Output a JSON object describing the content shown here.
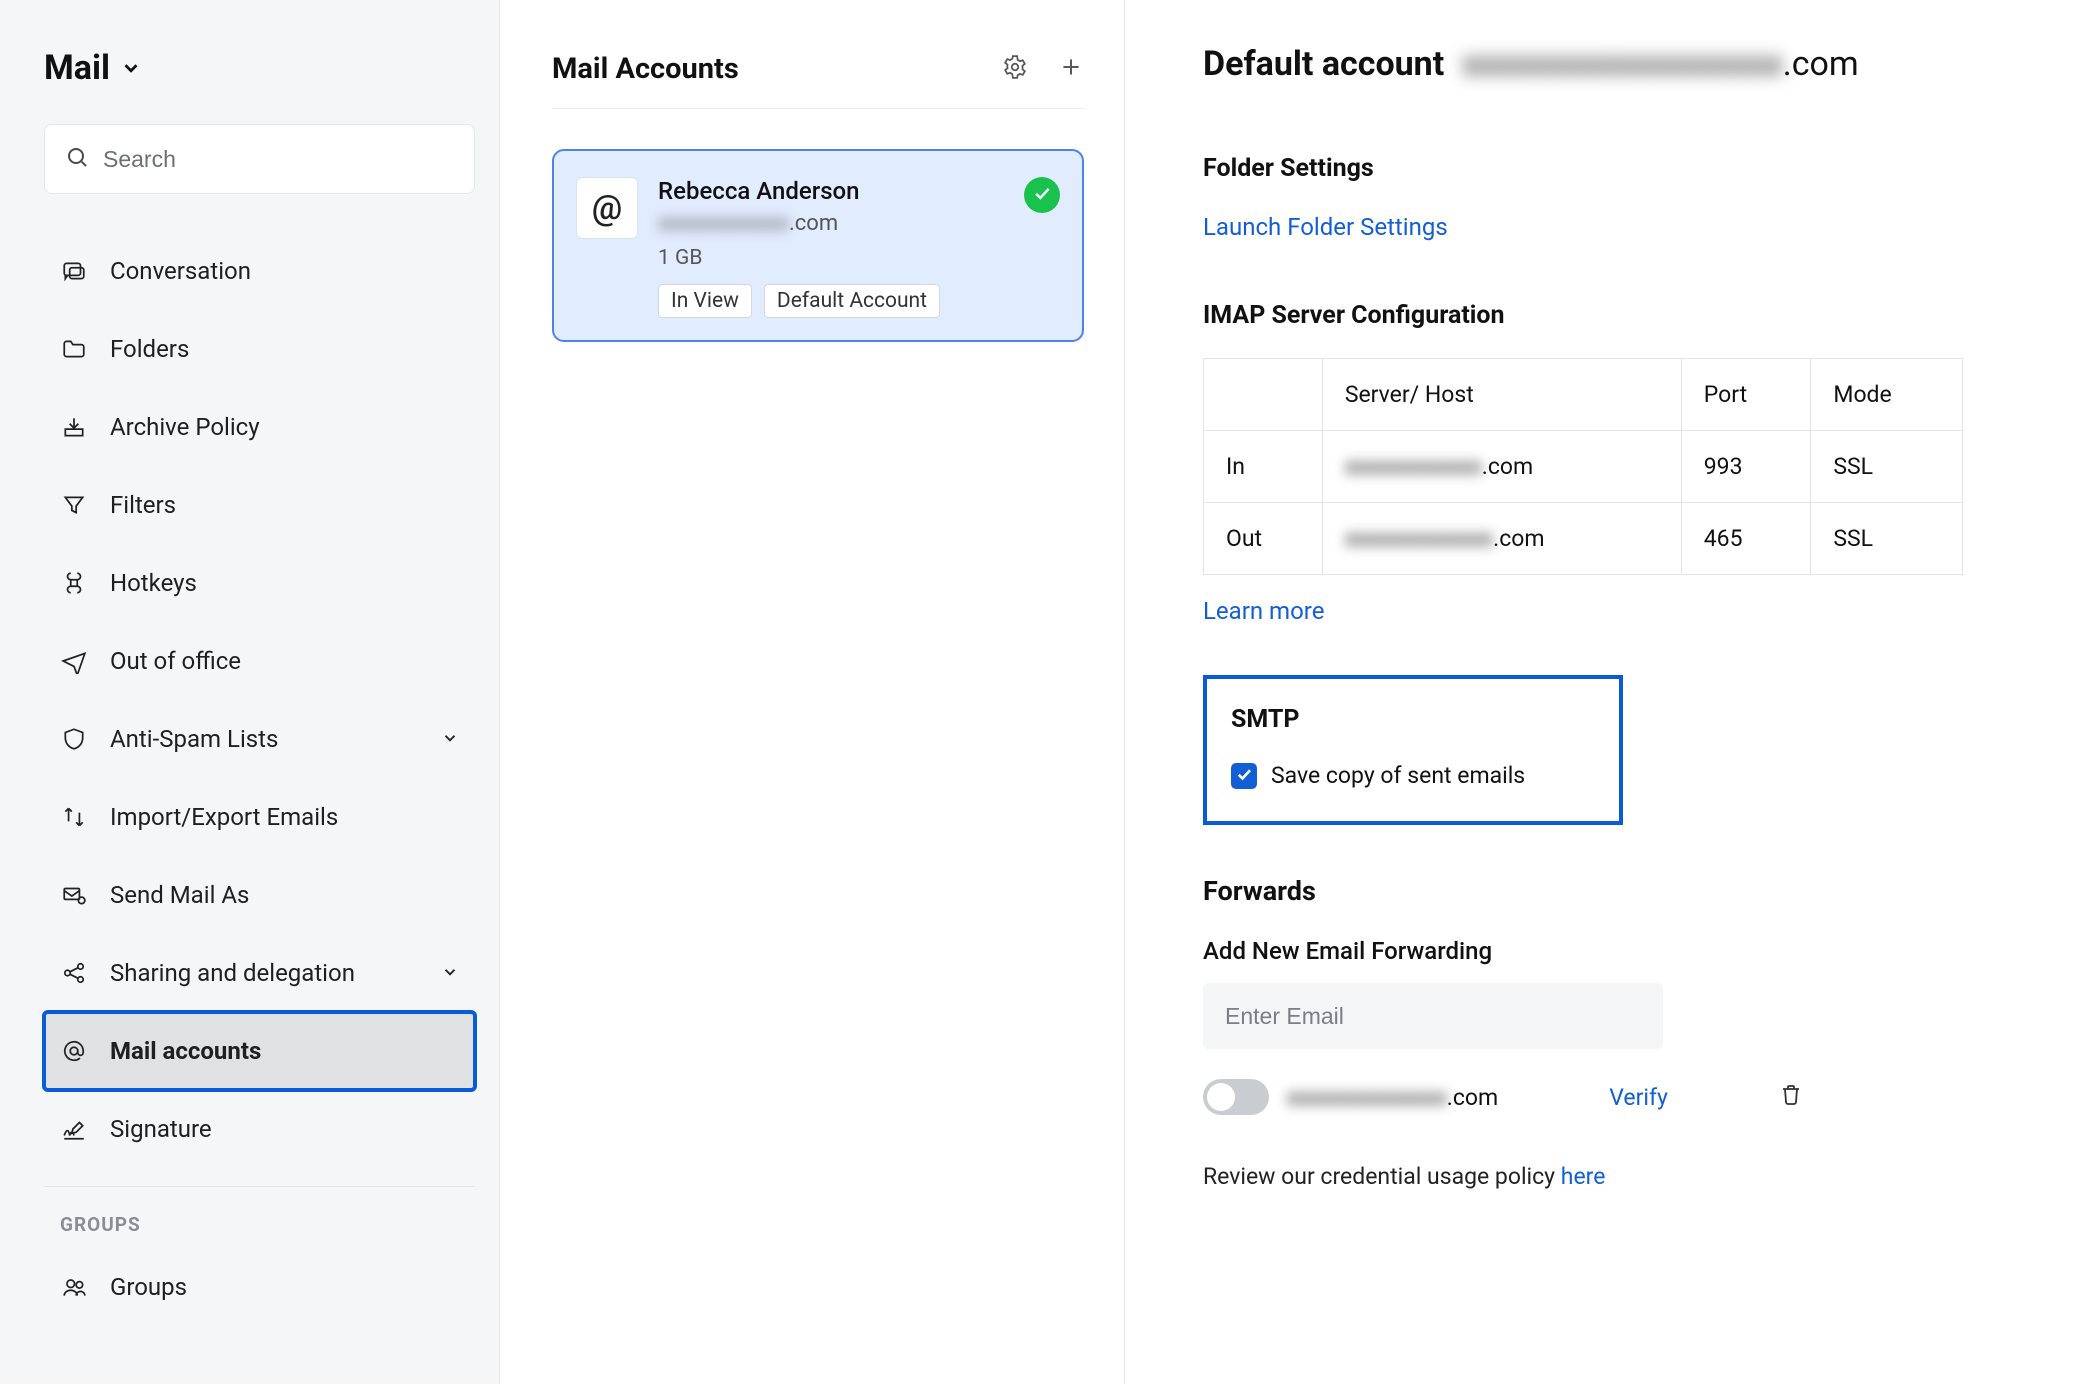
{
  "sidebar": {
    "title": "Mail",
    "search_placeholder": "Search",
    "items": [
      {
        "icon": "conversation",
        "label": "Conversation",
        "expandable": false
      },
      {
        "icon": "folder",
        "label": "Folders",
        "expandable": false
      },
      {
        "icon": "archive",
        "label": "Archive Policy",
        "expandable": false
      },
      {
        "icon": "filter",
        "label": "Filters",
        "expandable": false
      },
      {
        "icon": "hotkeys",
        "label": "Hotkeys",
        "expandable": false
      },
      {
        "icon": "outofoffice",
        "label": "Out of office",
        "expandable": false
      },
      {
        "icon": "shield",
        "label": "Anti-Spam Lists",
        "expandable": true
      },
      {
        "icon": "importexport",
        "label": "Import/Export Emails",
        "expandable": false
      },
      {
        "icon": "sendas",
        "label": "Send Mail As",
        "expandable": false
      },
      {
        "icon": "share",
        "label": "Sharing and delegation",
        "expandable": true
      },
      {
        "icon": "at",
        "label": "Mail accounts",
        "expandable": false,
        "active": true
      },
      {
        "icon": "signature",
        "label": "Signature",
        "expandable": false
      }
    ],
    "groups_label": "GROUPS",
    "groups_item_label": "Groups"
  },
  "midpanel": {
    "title": "Mail Accounts",
    "account": {
      "name": "Rebecca Anderson",
      "email_hidden": "xxxxxxxxxxxx",
      "email_suffix": ".com",
      "size": "1 GB",
      "tag_inview": "In View",
      "tag_default": "Default Account"
    }
  },
  "detail": {
    "title_prefix": "Default account",
    "title_email_hidden": "xxxxxxxxxxxxxxxxxxx",
    "title_email_suffix": ".com",
    "folder_settings_h": "Folder Settings",
    "launch_folder_settings": "Launch Folder Settings",
    "imap_h": "IMAP Server Configuration",
    "imap_headers": {
      "blank": "",
      "server": "Server/ Host",
      "port": "Port",
      "mode": "Mode"
    },
    "imap_rows": [
      {
        "dir": "In",
        "host_hidden": "xxxxxxxxxxxx",
        "host_suffix": ".com",
        "port": "993",
        "mode": "SSL"
      },
      {
        "dir": "Out",
        "host_hidden": "xxxxxxxxxxxxx",
        "host_suffix": ".com",
        "port": "465",
        "mode": "SSL"
      }
    ],
    "learn_more": "Learn more",
    "smtp_h": "SMTP",
    "smtp_checkbox_label": "Save copy of sent emails",
    "smtp_checked": true,
    "forwards_h": "Forwards",
    "add_fwd_label": "Add New Email Forwarding",
    "fwd_placeholder": "Enter Email",
    "fwd_row": {
      "email_hidden": "xxxxxxxxxxxxxx",
      "email_suffix": ".com",
      "verify": "Verify",
      "enabled": false
    },
    "policy_prefix": "Review our credential usage policy ",
    "policy_link": "here"
  }
}
